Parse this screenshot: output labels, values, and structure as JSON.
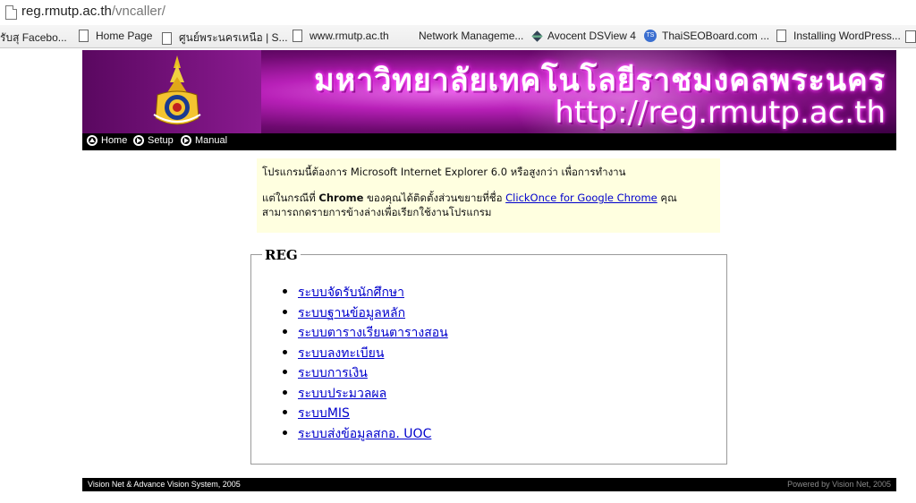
{
  "browser": {
    "address": {
      "host": "reg.rmutp.ac.th",
      "path": "/vncaller/"
    },
    "bookmarks": [
      {
        "label": "รับสุ Facebo...",
        "icon": "none"
      },
      {
        "label": "Home Page",
        "icon": "page-icon"
      },
      {
        "label": "ศูนย์พระนครเหนือ | S...",
        "icon": "page-icon"
      },
      {
        "label": "www.rmutp.ac.th",
        "icon": "page-icon"
      },
      {
        "label": "Network Manageme...",
        "icon": "none"
      },
      {
        "label": "Avocent DSView 4",
        "icon": "dsview-icon"
      },
      {
        "label": "ThaiSEOBoard.com ...",
        "icon": "thaiseo-icon"
      },
      {
        "label": "Installing WordPress...",
        "icon": "page-icon"
      }
    ]
  },
  "banner": {
    "title_th": "มหาวิทยาลัยเทคโนโลยีราชมงคลพระนคร",
    "url": "http://reg.rmutp.ac.th",
    "colors": {
      "primary": "#b820b8",
      "dark": "#3c0044"
    }
  },
  "nav": {
    "items": [
      {
        "label": "Home",
        "icon": "home-icon"
      },
      {
        "label": "Setup",
        "icon": "arrow-right-icon"
      },
      {
        "label": "Manual",
        "icon": "arrow-right-icon"
      }
    ]
  },
  "notice": {
    "line1": "โปรแกรมนี้ต้องการ Microsoft Internet Explorer 6.0 หรือสูงกว่า เพื่อการทำงาน",
    "line2_pre": "แต่ในกรณีที่ ",
    "line2_bold": "Chrome",
    "line2_mid": " ของคุณได้ติดตั้งส่วนขยายที่ชื่อ ",
    "line2_link": "ClickOnce for Google Chrome",
    "line2_post": " คุณสามารถกดรายการข้างล่างเพื่อเรียกใช้งานโปรแกรม"
  },
  "reg": {
    "legend": "REG",
    "items": [
      "ระบบจัดรับนักศึกษา",
      "ระบบฐานข้อมูลหลัก",
      "ระบบตารางเรียนตารางสอน",
      "ระบบลงทะเบียน",
      "ระบบการเงิน",
      "ระบบประมวลผล",
      "ระบบMIS",
      "ระบบส่งข้อมูลสกอ. UOC"
    ]
  },
  "footer": {
    "left": "Vision Net & Advance Vision System, 2005",
    "right": "Powered by Vision Net, 2005"
  }
}
